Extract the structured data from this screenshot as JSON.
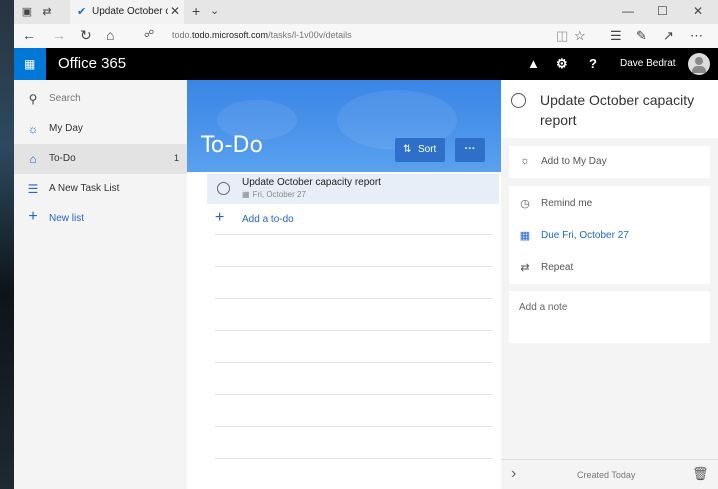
{
  "browser": {
    "tab_title": "Update October capacit",
    "url_host": "todo.microsoft.com",
    "url_path": "/tasks/l-1v00v/details",
    "url_prefix": "todo."
  },
  "header": {
    "app_name": "Office 365",
    "user_name": "Dave Bedrat"
  },
  "sidebar": {
    "search_label": "Search",
    "items": [
      {
        "label": "My Day",
        "icon": "sun-icon",
        "count": ""
      },
      {
        "label": "To-Do",
        "icon": "home-icon",
        "count": "1"
      },
      {
        "label": "A New Task List",
        "icon": "list-icon",
        "count": ""
      }
    ],
    "new_list_label": "New list"
  },
  "main": {
    "title": "To-Do",
    "sort_label": "Sort",
    "more_label": "···",
    "tasks": [
      {
        "title": "Update October capacity report",
        "due": "Fri, October 27"
      }
    ],
    "add_todo_label": "Add a to-do"
  },
  "detail": {
    "task_title": "Update October capacity report",
    "add_to_my_day": "Add to My Day",
    "remind_me": "Remind me",
    "due": "Due Fri, October 27",
    "repeat": "Repeat",
    "note_placeholder": "Add a note",
    "created": "Created Today"
  },
  "colors": {
    "accent": "#2564cf",
    "banner": "#4a93ea",
    "waffle": "#0078d7"
  }
}
